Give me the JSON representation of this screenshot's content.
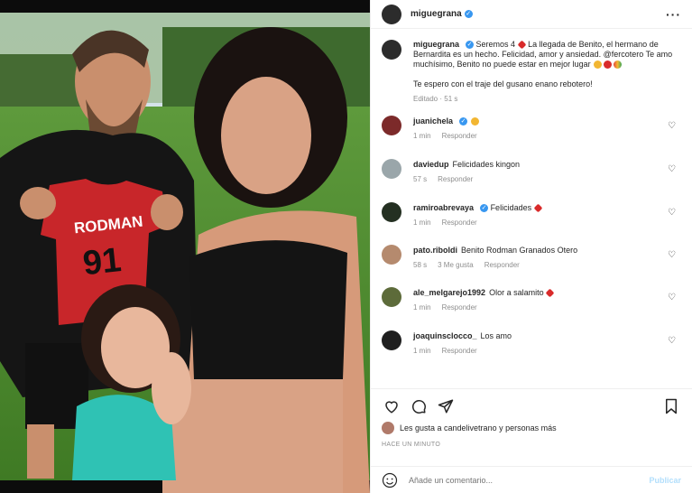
{
  "header": {
    "username": "miguegrana",
    "more_icon": "more-horizontal-icon"
  },
  "caption": {
    "username": "miguegrana",
    "text_1": "Seremos 4",
    "text_2": "La llegada de Benito, el hermano de Bernardita es un hecho. Felicidad, amor y ansiedad. @fercotero Te amo muchísimo, Benito no puede estar en mejor lugar",
    "text_3": "Te espero con el traje del gusano enano rebotero!",
    "edited": "Editado",
    "time": "51 s"
  },
  "comments": [
    {
      "user": "juanichela",
      "verified": true,
      "text": "",
      "time": "1 min",
      "reply": "Responder",
      "likes": ""
    },
    {
      "user": "daviedup",
      "verified": false,
      "text": "Felicidades kingon",
      "time": "57 s",
      "reply": "Responder",
      "likes": ""
    },
    {
      "user": "ramiroabrevaya",
      "verified": true,
      "text": "Felicidades",
      "time": "1 min",
      "reply": "Responder",
      "likes": ""
    },
    {
      "user": "pato.riboldi",
      "verified": false,
      "text": "Benito Rodman Granados Otero",
      "time": "58 s",
      "reply": "Responder",
      "likes": "3 Me gusta"
    },
    {
      "user": "ale_melgarejo1992",
      "verified": false,
      "text": "Olor a salamito",
      "time": "1 min",
      "reply": "Responder",
      "likes": ""
    },
    {
      "user": "joaquinsclocco_",
      "verified": false,
      "text": "Los amo",
      "time": "1 min",
      "reply": "Responder",
      "likes": ""
    }
  ],
  "actions": {
    "likes_text": "Les gusta a candelivetrano y personas más",
    "posted": "HACE UN MINUTO"
  },
  "add_comment": {
    "placeholder": "Añade un comentario...",
    "publish": "Publicar"
  },
  "photo": {
    "jersey_name": "RODMAN",
    "jersey_number": "91"
  },
  "colors": {
    "verified": "#3897f0",
    "publish_disabled": "#b2dffc",
    "muted": "#8e8e8e"
  }
}
